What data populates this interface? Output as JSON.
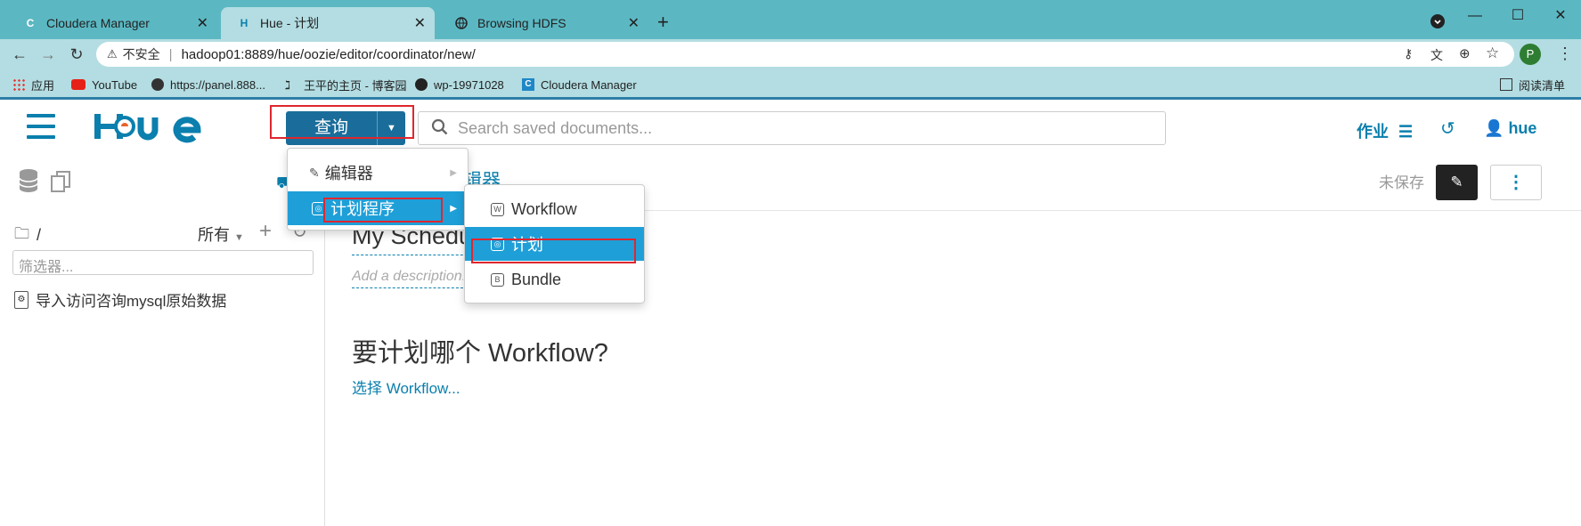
{
  "browser": {
    "tabs": [
      {
        "title": "Cloudera Manager",
        "favicon": "C"
      },
      {
        "title": "Hue - 计划",
        "favicon": "H"
      },
      {
        "title": "Browsing HDFS",
        "favicon": "globe"
      }
    ],
    "new_tab": "+",
    "security_label": "不安全",
    "url": "hadoop01:8889/hue/oozie/editor/coordinator/new/",
    "profile_initial": "P",
    "bookmarks": [
      "应用",
      "YouTube",
      "https://panel.888...",
      "王平的主页 - 博客园",
      "wp-19971028",
      "Cloudera Manager"
    ],
    "reading_list": "阅读清单"
  },
  "hue": {
    "query_button": "查询",
    "search_placeholder": "Search saved documents...",
    "jobs_label": "作业",
    "user": "hue",
    "unsaved": "未保存",
    "partial_title": "辑器",
    "menu": {
      "editor": "编辑器",
      "scheduler": "计划程序",
      "sub": [
        "Workflow",
        "计划",
        "Bundle"
      ]
    },
    "left": {
      "path": "/",
      "owner_filter": "所有",
      "filter_placeholder": "筛选器...",
      "items": [
        "导入访问咨询mysql原始数据"
      ]
    },
    "main": {
      "name": "My Schedule",
      "description_placeholder": "Add a description...",
      "question": "要计划哪个 Workflow?",
      "choose_link": "选择 Workflow..."
    }
  },
  "colors": {
    "hue_blue": "#0b7fad",
    "tab_bar": "#5bb8c3",
    "toolbar": "#b3dde2",
    "highlight": "#1e9fd8",
    "annotation": "#e0262f"
  }
}
